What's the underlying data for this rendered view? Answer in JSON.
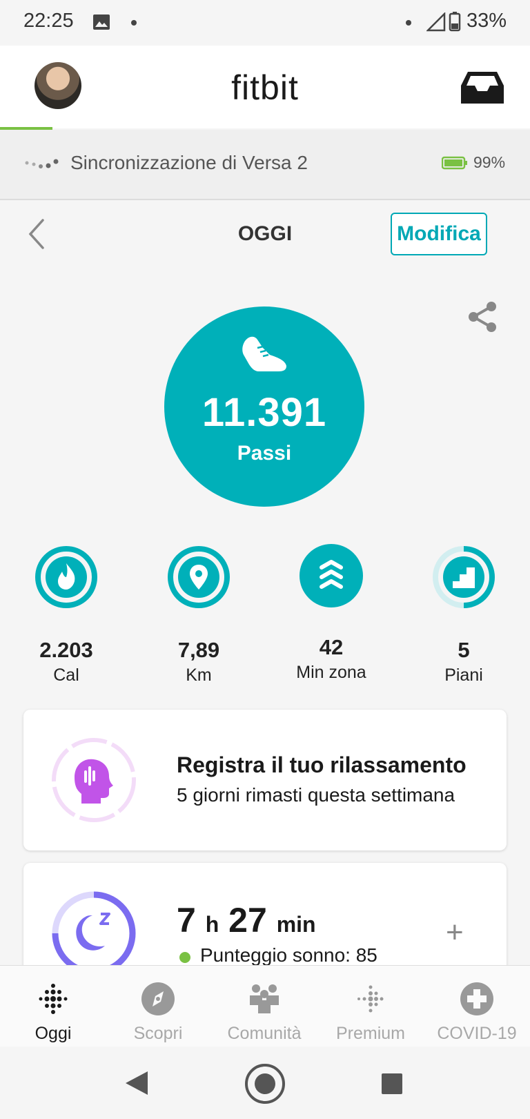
{
  "status_bar": {
    "time": "22:25",
    "battery_pct": "33%"
  },
  "header": {
    "logo": "fitbit"
  },
  "sync": {
    "text": "Sincronizzazione di Versa 2",
    "battery": "99%"
  },
  "date_row": {
    "title": "OGGI",
    "edit_label": "Modifica"
  },
  "steps": {
    "value": "11.391",
    "label": "Passi"
  },
  "stats": [
    {
      "value": "2.203",
      "label": "Cal",
      "icon": "flame-icon",
      "progress": 1.0
    },
    {
      "value": "7,89",
      "label": "Km",
      "icon": "location-pin-icon",
      "progress": 1.0
    },
    {
      "value": "42",
      "label": "Min zona",
      "icon": "zone-chevrons-icon",
      "progress": 1.0
    },
    {
      "value": "5",
      "label": "Piani",
      "icon": "stairs-icon",
      "progress": 0.5
    }
  ],
  "relax_card": {
    "title": "Registra il tuo rilassamento",
    "subtitle": "5 giorni rimasti questa settimana"
  },
  "sleep_card": {
    "hours": "7",
    "hours_unit": "h",
    "minutes": "27",
    "minutes_unit": "min",
    "score": "Punteggio sonno: 85"
  },
  "bottom_nav": [
    {
      "label": "Oggi",
      "icon": "today-dots-icon",
      "active": true
    },
    {
      "label": "Scopri",
      "icon": "compass-icon",
      "active": false
    },
    {
      "label": "Comunità",
      "icon": "community-icon",
      "active": false
    },
    {
      "label": "Premium",
      "icon": "premium-dots-icon",
      "active": false
    },
    {
      "label": "COVID-19",
      "icon": "medical-cross-icon",
      "active": false
    }
  ],
  "colors": {
    "teal": "#00b0b9",
    "green": "#7ac143",
    "purple_relax": "#c154e8",
    "purple_sleep": "#7b6cf0"
  }
}
